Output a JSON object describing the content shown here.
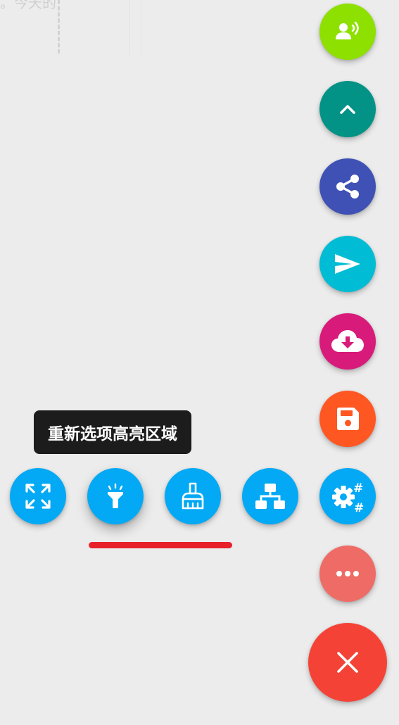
{
  "background": {
    "text": "。今天的"
  },
  "colors": {
    "voice": "#8ee000",
    "scroll_top": "#039386",
    "share": "#3f51b5",
    "send": "#00bcd4",
    "download": "#d81b7a",
    "save": "#ff5722",
    "settings": "#03a9f4",
    "more": "#ef6c66",
    "close": "#f44336",
    "tool": "#03a9f4",
    "underline": "#e8202a"
  },
  "fab_column": [
    {
      "name": "voice-button",
      "icon": "voice-icon"
    },
    {
      "name": "scroll-top-button",
      "icon": "chevron-up-icon"
    },
    {
      "name": "share-button",
      "icon": "share-icon"
    },
    {
      "name": "send-button",
      "icon": "send-icon"
    },
    {
      "name": "cloud-download-button",
      "icon": "cloud-download-icon"
    },
    {
      "name": "save-button",
      "icon": "save-icon"
    },
    {
      "name": "settings-button",
      "icon": "gears-icon"
    },
    {
      "name": "more-button",
      "icon": "more-dots-icon"
    },
    {
      "name": "close-button",
      "icon": "close-icon"
    }
  ],
  "tool_row": [
    {
      "name": "expand-button",
      "icon": "expand-icon"
    },
    {
      "name": "highlight-button",
      "icon": "flashlight-icon",
      "selected": true
    },
    {
      "name": "clean-button",
      "icon": "broom-icon"
    },
    {
      "name": "sitemap-button",
      "icon": "sitemap-icon"
    }
  ],
  "tooltip": {
    "text": "重新选项高亮区域"
  }
}
